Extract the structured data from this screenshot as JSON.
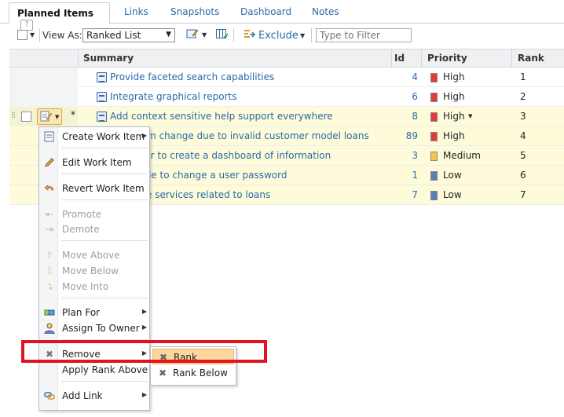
{
  "tabs": [
    {
      "label": "Planned Items",
      "active": true,
      "help": "?"
    },
    {
      "label": "Links"
    },
    {
      "label": "Snapshots"
    },
    {
      "label": "Dashboard"
    },
    {
      "label": "Notes"
    }
  ],
  "toolbar": {
    "view_as_label": "View As:",
    "view_as_value": "Ranked List",
    "exclude_label": "Exclude",
    "filter_placeholder": "Type to Filter"
  },
  "table": {
    "columns": {
      "summary": "Summary",
      "id": "Id",
      "priority": "Priority",
      "rank": "Rank"
    },
    "rows": [
      {
        "summary": "Provide faceted search capabilities",
        "id": "4",
        "priority": "High",
        "rank": "1"
      },
      {
        "summary": "Integrate graphical reports",
        "id": "6",
        "priority": "High",
        "rank": "2"
      },
      {
        "summary": "Add context sensitive help support everywhere",
        "id": "8",
        "priority": "High",
        "rank": "3",
        "marker": "*"
      },
      {
        "summary": "orm change due to invalid customer model loans",
        "id": "89",
        "priority": "High",
        "rank": "4"
      },
      {
        "summary": "ser to create a dashboard of information",
        "id": "3",
        "priority": "Medium",
        "rank": "5"
      },
      {
        "summary": "ible to change a user password",
        "id": "1",
        "priority": "Low",
        "rank": "6"
      },
      {
        "summary": "e services related to loans",
        "id": "7",
        "priority": "Low",
        "rank": "7"
      }
    ]
  },
  "priority_colors": {
    "High": "#e23a3a",
    "Medium": "#f2c744",
    "Low": "#5b7fb8"
  },
  "context_menu": {
    "items": [
      {
        "label": "Create Work Item",
        "has_sub": true
      },
      {
        "label": "Edit Work Item"
      },
      {
        "label": "Revert Work Item"
      },
      {
        "label": "Promote",
        "disabled": true
      },
      {
        "label": "Demote",
        "disabled": true
      },
      {
        "label": "Move Above",
        "disabled": true
      },
      {
        "label": "Move Below",
        "disabled": true
      },
      {
        "label": "Move Into",
        "disabled": true
      },
      {
        "label": "Plan For",
        "has_sub": true
      },
      {
        "label": "Assign To Owner",
        "has_sub": true
      },
      {
        "label": "Remove",
        "has_sub": true
      },
      {
        "label": "Apply Rank Above"
      },
      {
        "label": "Add Link",
        "has_sub": true
      }
    ],
    "remove_submenu": [
      {
        "label": "Rank",
        "highlighted": true
      },
      {
        "label": "Rank Below"
      }
    ]
  },
  "accent_highlight": "#e0141e"
}
